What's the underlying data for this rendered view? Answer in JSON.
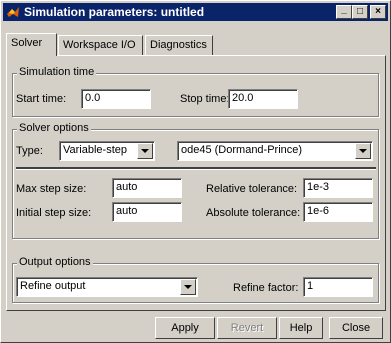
{
  "window": {
    "title": "Simulation parameters: untitled",
    "icon": "matlab-icon",
    "controls": [
      "_",
      "□",
      "×"
    ]
  },
  "tabs": [
    {
      "label": "Solver",
      "active": true
    },
    {
      "label": "Workspace I/O",
      "active": false
    },
    {
      "label": "Diagnostics",
      "active": false
    }
  ],
  "simulation_time": {
    "legend": "Simulation time",
    "start_label": "Start time:",
    "start_value": "0.0",
    "stop_label": "Stop time:",
    "stop_value": "20.0"
  },
  "solver_options": {
    "legend": "Solver options",
    "type_label": "Type:",
    "type_value": "Variable-step",
    "solver_value": "ode45 (Dormand-Prince)",
    "max_step_label": "Max step size:",
    "max_step_value": "auto",
    "initial_step_label": "Initial step size:",
    "initial_step_value": "auto",
    "rel_tol_label": "Relative tolerance:",
    "rel_tol_value": "1e-3",
    "abs_tol_label": "Absolute tolerance:",
    "abs_tol_value": "1e-6"
  },
  "output_options": {
    "legend": "Output options",
    "mode_value": "Refine output",
    "refine_label": "Refine factor:",
    "refine_value": "1"
  },
  "buttons": {
    "apply": "Apply",
    "revert": "Revert",
    "help": "Help",
    "close": "Close"
  }
}
